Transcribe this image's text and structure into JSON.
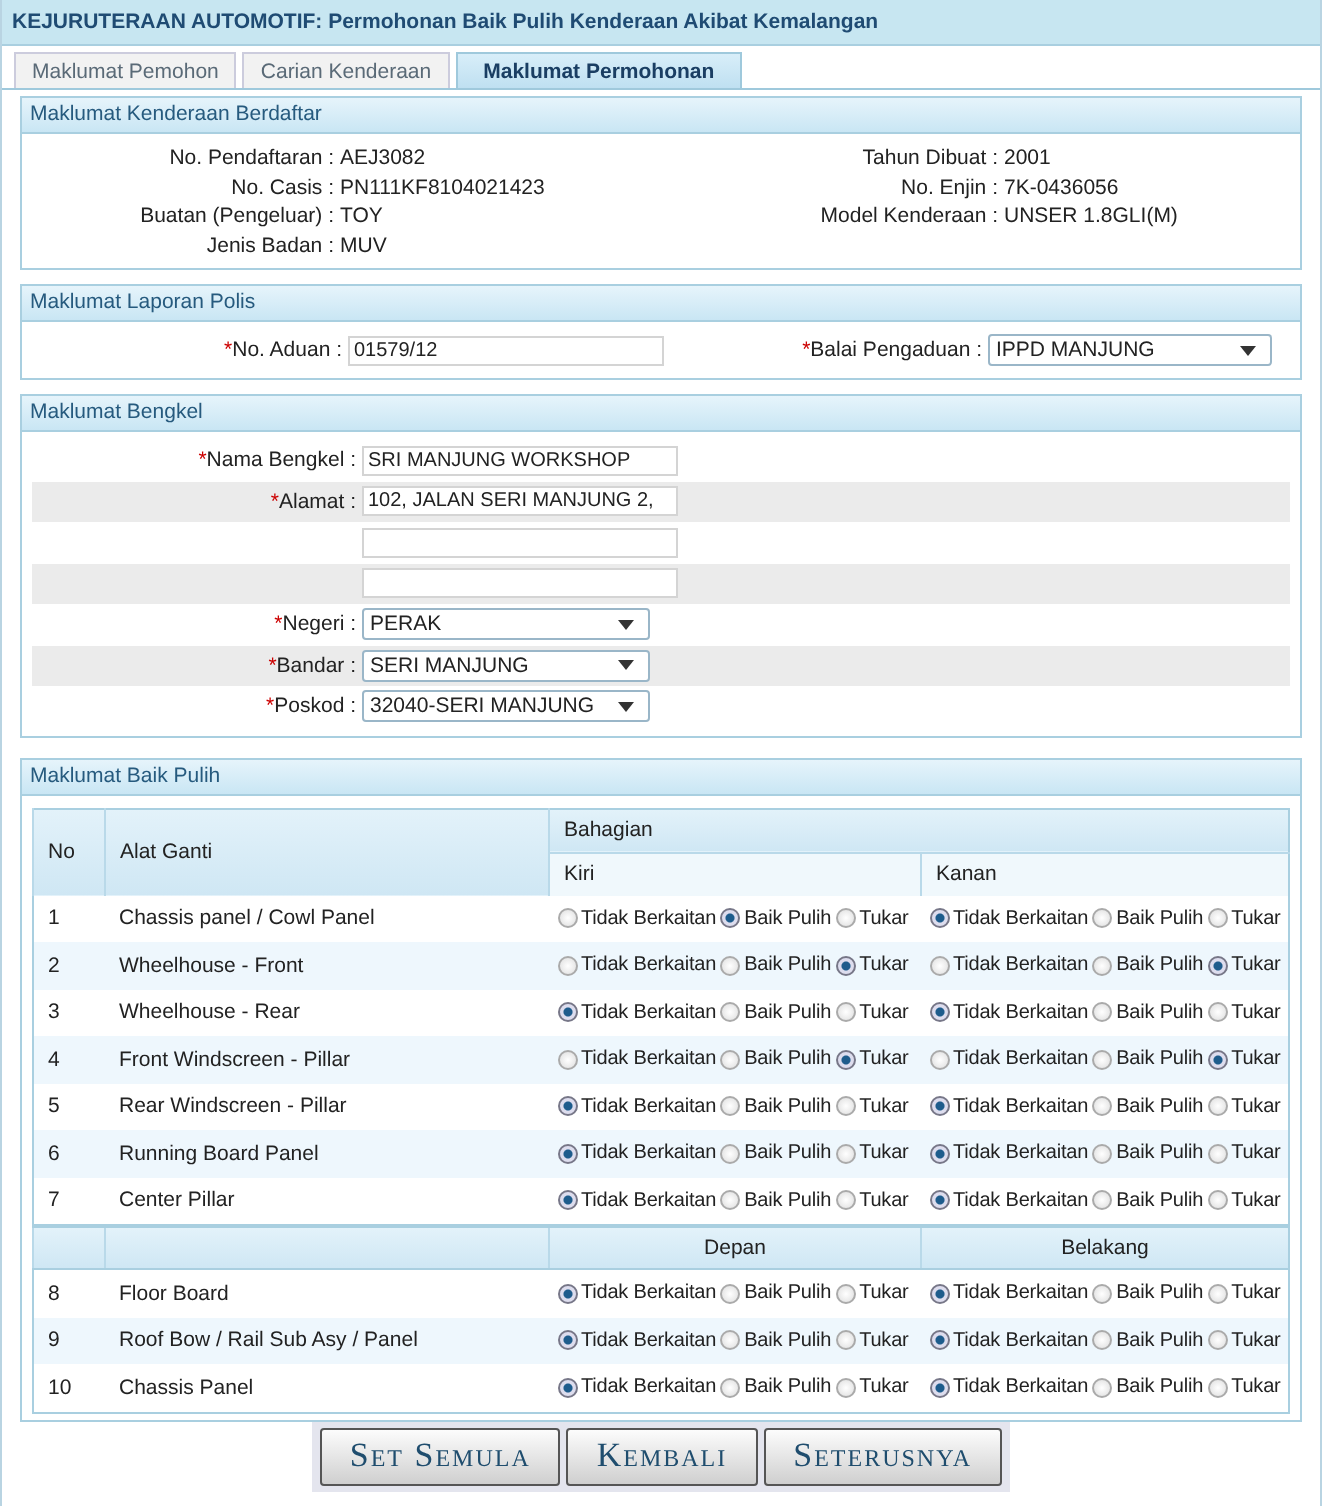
{
  "header": {
    "title": "KEJURUTERAAN AUTOMOTIF: Permohonan Baik Pulih Kenderaan Akibat Kemalangan"
  },
  "tabs": [
    {
      "label": "Maklumat Pemohon",
      "selected": false
    },
    {
      "label": "Carian Kenderaan",
      "selected": false
    },
    {
      "label": "Maklumat Permohonan",
      "selected": true
    }
  ],
  "vehicle": {
    "title": "Maklumat Kenderaan Berdaftar",
    "rows": [
      {
        "left": {
          "label": "No. Pendaftaran :",
          "value": "AEJ3082"
        },
        "right": {
          "label": "Tahun Dibuat :",
          "value": "2001"
        }
      },
      {
        "left": {
          "label": "No. Casis :",
          "value": "PN111KF8104021423"
        },
        "right": {
          "label": "No. Enjin :",
          "value": "7K-0436056"
        }
      },
      {
        "left": {
          "label": "Buatan (Pengeluar) :",
          "value": "TOY"
        },
        "right": {
          "label": "Model Kenderaan :",
          "value": "UNSER 1.8GLI(M)"
        }
      },
      {
        "left": {
          "label": "Jenis Badan :",
          "value": "MUV"
        }
      }
    ]
  },
  "police": {
    "title": "Maklumat Laporan Polis",
    "fields": [
      {
        "kind": "text",
        "mark": "*",
        "label": "No. Aduan :",
        "value": "01579/12"
      },
      {
        "kind": "select",
        "mark": "*",
        "label": "Balai Pengaduan :",
        "value": "IPPD MANJUNG"
      }
    ]
  },
  "workshop": {
    "title": "Maklumat Bengkel",
    "rows": [
      {
        "kind": "text",
        "mark": "*",
        "label": "Nama Bengkel :",
        "value": "SRI MANJUNG WORKSHOP"
      },
      {
        "kind": "text",
        "mark": "*",
        "label": "Alamat :",
        "value": "102, JALAN SERI MANJUNG 2,"
      },
      {
        "kind": "text"
      },
      {
        "kind": "text"
      },
      {
        "kind": "select",
        "mark": "*",
        "label": "Negeri :",
        "value": "PERAK"
      },
      {
        "kind": "select",
        "mark": "*",
        "label": "Bandar :",
        "value": "SERI MANJUNG"
      },
      {
        "kind": "select",
        "mark": "*",
        "label": "Poskod :",
        "value": "32040-SERI MANJUNG"
      }
    ]
  },
  "repair": {
    "title": "Maklumat Baik Pulih",
    "columns": {
      "no": "No",
      "part": "Alat Ganti",
      "section": "Bahagian",
      "left": "Kiri",
      "right": "Kanan"
    },
    "rows": [
      {
        "no": "1",
        "part": "Chassis panel / Cowl Panel",
        "left": [
          {
            "label": "Tidak Berkaitan",
            "selected": false
          },
          {
            "label": "Baik Pulih",
            "selected": true
          },
          {
            "label": "Tukar",
            "selected": false
          }
        ],
        "right": [
          {
            "label": "Tidak Berkaitan",
            "selected": true
          },
          {
            "label": "Baik Pulih",
            "selected": false
          },
          {
            "label": "Tukar",
            "selected": false
          }
        ]
      },
      {
        "no": "2",
        "part": "Wheelhouse - Front",
        "left": [
          {
            "label": "Tidak Berkaitan",
            "selected": false
          },
          {
            "label": "Baik Pulih",
            "selected": false
          },
          {
            "label": "Tukar",
            "selected": true
          }
        ],
        "right": [
          {
            "label": "Tidak Berkaitan",
            "selected": false
          },
          {
            "label": "Baik Pulih",
            "selected": false
          },
          {
            "label": "Tukar",
            "selected": true
          }
        ]
      },
      {
        "no": "3",
        "part": "Wheelhouse - Rear",
        "left": [
          {
            "label": "Tidak Berkaitan",
            "selected": true
          },
          {
            "label": "Baik Pulih",
            "selected": false
          },
          {
            "label": "Tukar",
            "selected": false
          }
        ],
        "right": [
          {
            "label": "Tidak Berkaitan",
            "selected": true
          },
          {
            "label": "Baik Pulih",
            "selected": false
          },
          {
            "label": "Tukar",
            "selected": false
          }
        ]
      },
      {
        "no": "4",
        "part": "Front Windscreen - Pillar",
        "left": [
          {
            "label": "Tidak Berkaitan",
            "selected": false
          },
          {
            "label": "Baik Pulih",
            "selected": false
          },
          {
            "label": "Tukar",
            "selected": true
          }
        ],
        "right": [
          {
            "label": "Tidak Berkaitan",
            "selected": false
          },
          {
            "label": "Baik Pulih",
            "selected": false
          },
          {
            "label": "Tukar",
            "selected": true
          }
        ]
      },
      {
        "no": "5",
        "part": "Rear Windscreen - Pillar",
        "left": [
          {
            "label": "Tidak Berkaitan",
            "selected": true
          },
          {
            "label": "Baik Pulih",
            "selected": false
          },
          {
            "label": "Tukar",
            "selected": false
          }
        ],
        "right": [
          {
            "label": "Tidak Berkaitan",
            "selected": true
          },
          {
            "label": "Baik Pulih",
            "selected": false
          },
          {
            "label": "Tukar",
            "selected": false
          }
        ]
      },
      {
        "no": "6",
        "part": "Running Board Panel",
        "left": [
          {
            "label": "Tidak Berkaitan",
            "selected": true
          },
          {
            "label": "Baik Pulih",
            "selected": false
          },
          {
            "label": "Tukar",
            "selected": false
          }
        ],
        "right": [
          {
            "label": "Tidak Berkaitan",
            "selected": true
          },
          {
            "label": "Baik Pulih",
            "selected": false
          },
          {
            "label": "Tukar",
            "selected": false
          }
        ]
      },
      {
        "no": "7",
        "part": "Center Pillar",
        "left": [
          {
            "label": "Tidak Berkaitan",
            "selected": true
          },
          {
            "label": "Baik Pulih",
            "selected": false
          },
          {
            "label": "Tukar",
            "selected": false
          }
        ],
        "right": [
          {
            "label": "Tidak Berkaitan",
            "selected": true
          },
          {
            "label": "Baik Pulih",
            "selected": false
          },
          {
            "label": "Tukar",
            "selected": false
          }
        ]
      }
    ],
    "group2": {
      "left": "Depan",
      "right": "Belakang",
      "rows": [
        {
          "no": "8",
          "part": "Floor Board",
          "left": [
            {
              "label": "Tidak Berkaitan",
              "selected": true
            },
            {
              "label": "Baik Pulih",
              "selected": false
            },
            {
              "label": "Tukar",
              "selected": false
            }
          ],
          "right": [
            {
              "label": "Tidak Berkaitan",
              "selected": true
            },
            {
              "label": "Baik Pulih",
              "selected": false
            },
            {
              "label": "Tukar",
              "selected": false
            }
          ]
        },
        {
          "no": "9",
          "part": "Roof Bow / Rail Sub Asy / Panel",
          "left": [
            {
              "label": "Tidak Berkaitan",
              "selected": true
            },
            {
              "label": "Baik Pulih",
              "selected": false
            },
            {
              "label": "Tukar",
              "selected": false
            }
          ],
          "right": [
            {
              "label": "Tidak Berkaitan",
              "selected": true
            },
            {
              "label": "Baik Pulih",
              "selected": false
            },
            {
              "label": "Tukar",
              "selected": false
            }
          ]
        },
        {
          "no": "10",
          "part": "Chassis Panel",
          "left": [
            {
              "label": "Tidak Berkaitan",
              "selected": true
            },
            {
              "label": "Baik Pulih",
              "selected": false
            },
            {
              "label": "Tukar",
              "selected": false
            }
          ],
          "right": [
            {
              "label": "Tidak Berkaitan",
              "selected": true
            },
            {
              "label": "Baik Pulih",
              "selected": false
            },
            {
              "label": "Tukar",
              "selected": false
            }
          ]
        }
      ]
    }
  },
  "buttons": [
    "Set Semula",
    "Kembali",
    "Seterusnya"
  ]
}
